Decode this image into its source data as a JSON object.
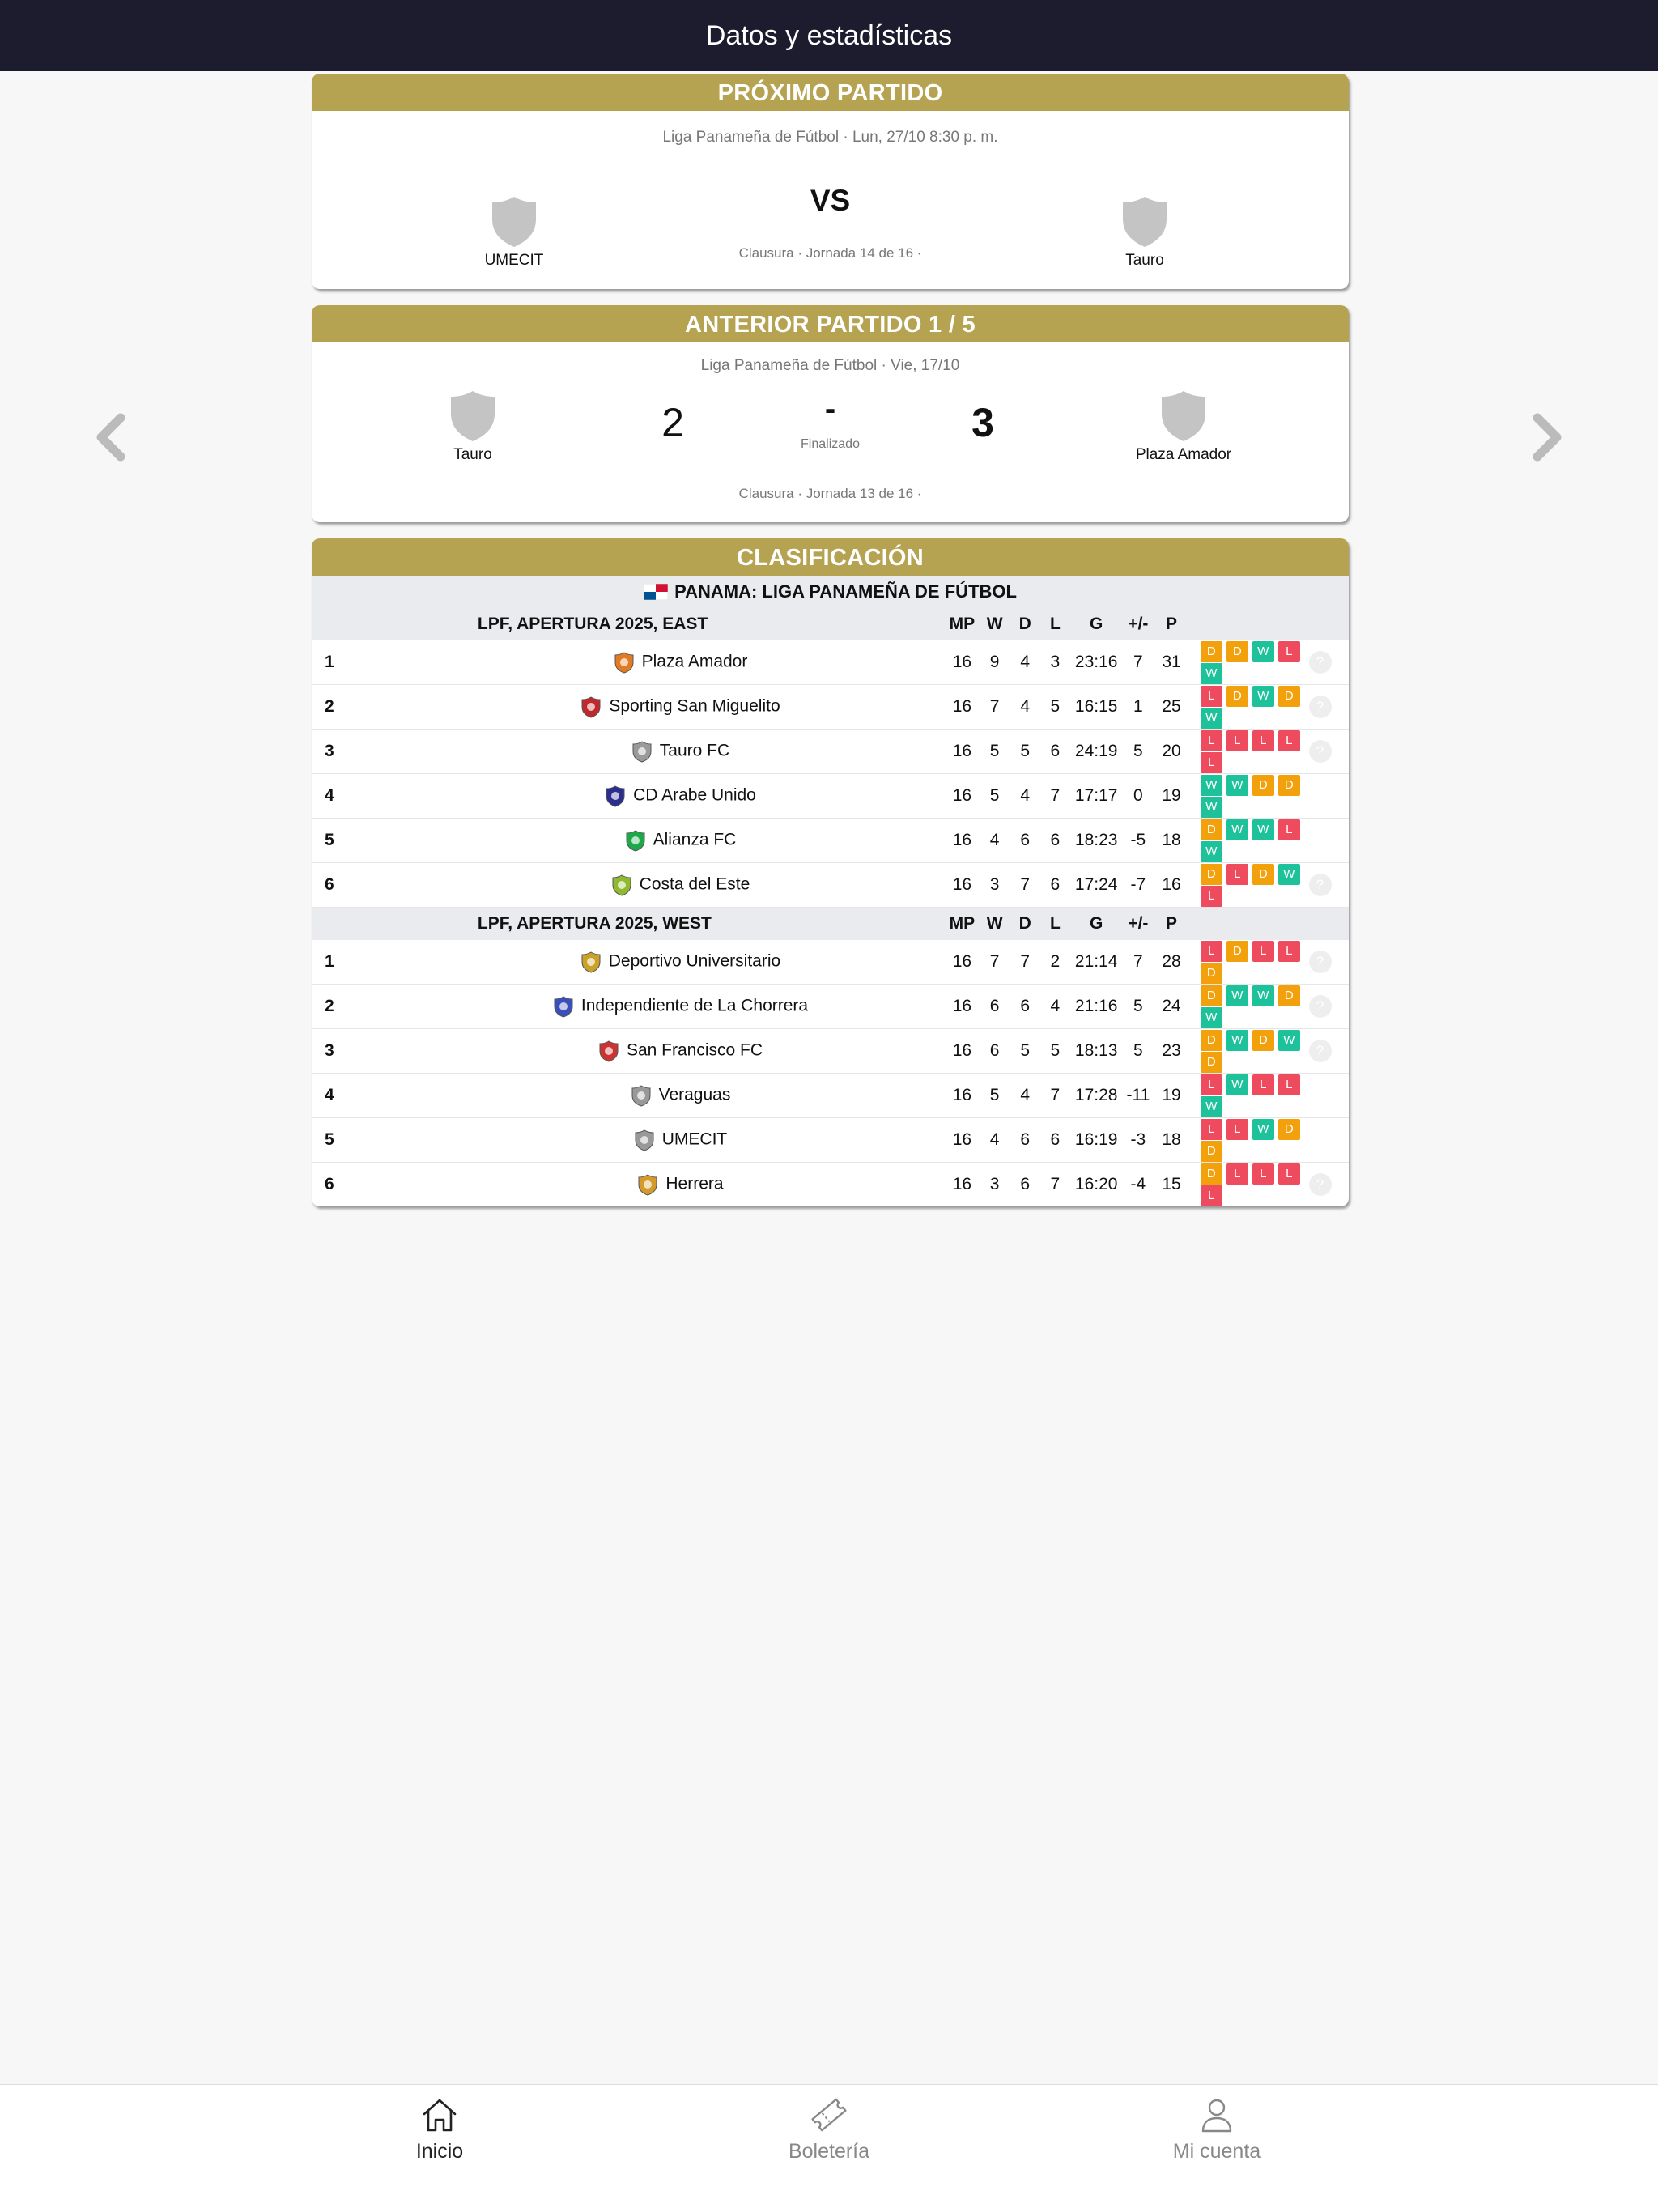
{
  "header": {
    "title": "Datos y estadísticas"
  },
  "next_match": {
    "heading": "PRÓXIMO PARTIDO",
    "meta": "Liga Panameña de Fútbol · Lun, 27/10 8:30 p. m.",
    "home": "UMECIT",
    "away": "Tauro",
    "vs": "VS",
    "footer": "Clausura · Jornada 14 de 16 ·"
  },
  "previous_match": {
    "heading": "ANTERIOR PARTIDO 1 / 5",
    "meta": "Liga Panameña de Fútbol · Vie, 17/10",
    "home": "Tauro",
    "away": "Plaza Amador",
    "home_score": "2",
    "away_score": "3",
    "dash": "-",
    "status": "Finalizado",
    "footer": "Clausura · Jornada 13 de 16 ·"
  },
  "standings": {
    "heading": "CLASIFICACIÓN",
    "league": "PANAMA: LIGA PANAMEÑA DE FÚTBOL",
    "columns": [
      "MP",
      "W",
      "D",
      "L",
      "G",
      "+/-",
      "P"
    ],
    "groups": [
      {
        "name": "LPF, APERTURA 2025, EAST",
        "rows": [
          {
            "pos": "1",
            "team": "Plaza Amador",
            "mp": "16",
            "w": "9",
            "d": "4",
            "l": "3",
            "g": "23:16",
            "gd": "7",
            "p": "31",
            "form": [
              "D",
              "D",
              "W",
              "L",
              "W"
            ],
            "q": true
          },
          {
            "pos": "2",
            "team": "Sporting San Miguelito",
            "mp": "16",
            "w": "7",
            "d": "4",
            "l": "5",
            "g": "16:15",
            "gd": "1",
            "p": "25",
            "form": [
              "L",
              "D",
              "W",
              "D",
              "W"
            ],
            "q": true
          },
          {
            "pos": "3",
            "team": "Tauro FC",
            "mp": "16",
            "w": "5",
            "d": "5",
            "l": "6",
            "g": "24:19",
            "gd": "5",
            "p": "20",
            "form": [
              "L",
              "L",
              "L",
              "L",
              "L"
            ],
            "q": true
          },
          {
            "pos": "4",
            "team": "CD Arabe Unido",
            "mp": "16",
            "w": "5",
            "d": "4",
            "l": "7",
            "g": "17:17",
            "gd": "0",
            "p": "19",
            "form": [
              "W",
              "W",
              "D",
              "D",
              "W"
            ],
            "q": false
          },
          {
            "pos": "5",
            "team": "Alianza FC",
            "mp": "16",
            "w": "4",
            "d": "6",
            "l": "6",
            "g": "18:23",
            "gd": "-5",
            "p": "18",
            "form": [
              "D",
              "W",
              "W",
              "L",
              "W"
            ],
            "q": false
          },
          {
            "pos": "6",
            "team": "Costa del Este",
            "mp": "16",
            "w": "3",
            "d": "7",
            "l": "6",
            "g": "17:24",
            "gd": "-7",
            "p": "16",
            "form": [
              "D",
              "L",
              "D",
              "W",
              "L"
            ],
            "q": true
          }
        ]
      },
      {
        "name": "LPF, APERTURA 2025, WEST",
        "rows": [
          {
            "pos": "1",
            "team": "Deportivo Universitario",
            "mp": "16",
            "w": "7",
            "d": "7",
            "l": "2",
            "g": "21:14",
            "gd": "7",
            "p": "28",
            "form": [
              "L",
              "D",
              "L",
              "L",
              "D"
            ],
            "q": true
          },
          {
            "pos": "2",
            "team": "Independiente de La Chorrera",
            "mp": "16",
            "w": "6",
            "d": "6",
            "l": "4",
            "g": "21:16",
            "gd": "5",
            "p": "24",
            "form": [
              "D",
              "W",
              "W",
              "D",
              "W"
            ],
            "q": true
          },
          {
            "pos": "3",
            "team": "San Francisco FC",
            "mp": "16",
            "w": "6",
            "d": "5",
            "l": "5",
            "g": "18:13",
            "gd": "5",
            "p": "23",
            "form": [
              "D",
              "W",
              "D",
              "W",
              "D"
            ],
            "q": true
          },
          {
            "pos": "4",
            "team": "Veraguas",
            "mp": "16",
            "w": "5",
            "d": "4",
            "l": "7",
            "g": "17:28",
            "gd": "-11",
            "p": "19",
            "form": [
              "L",
              "W",
              "L",
              "L",
              "W"
            ],
            "q": false
          },
          {
            "pos": "5",
            "team": "UMECIT",
            "mp": "16",
            "w": "4",
            "d": "6",
            "l": "6",
            "g": "16:19",
            "gd": "-3",
            "p": "18",
            "form": [
              "L",
              "L",
              "W",
              "D",
              "D"
            ],
            "q": false
          },
          {
            "pos": "6",
            "team": "Herrera",
            "mp": "16",
            "w": "3",
            "d": "6",
            "l": "7",
            "g": "16:20",
            "gd": "-4",
            "p": "15",
            "form": [
              "D",
              "L",
              "L",
              "L",
              "L"
            ],
            "q": true
          }
        ]
      }
    ]
  },
  "tabbar": {
    "items": [
      {
        "label": "Inicio",
        "icon": "home-icon",
        "active": true
      },
      {
        "label": "Boletería",
        "icon": "ticket-icon",
        "active": false
      },
      {
        "label": "Mi cuenta",
        "icon": "user-icon",
        "active": false
      }
    ]
  },
  "colors": {
    "header_bg": "#1c1c2e",
    "card_head": "#b5a352",
    "win": "#1ec29a",
    "draw": "#f2a10c",
    "loss": "#ee4b5f"
  }
}
